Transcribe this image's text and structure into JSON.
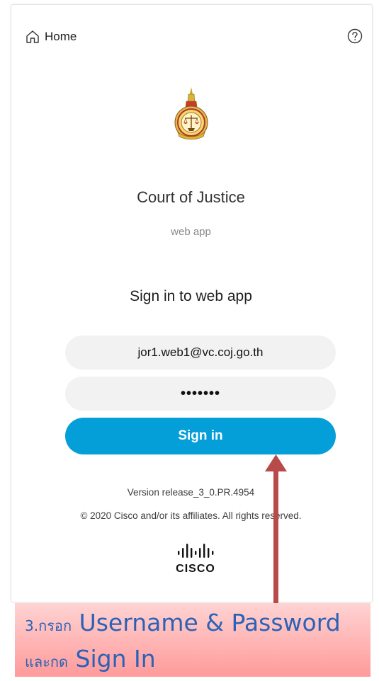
{
  "header": {
    "home_label": "Home",
    "home_icon": "home-icon",
    "help_icon": "help-icon"
  },
  "branding": {
    "logo_icon": "court-of-justice-emblem",
    "org_name": "Court of Justice",
    "app_subtitle": "web app"
  },
  "signin": {
    "title": "Sign in to web app",
    "email_value": "jor1.web1@vc.coj.go.th",
    "password_value": "•••••••",
    "button_label": "Sign in",
    "button_color": "#049fd9"
  },
  "footer": {
    "version": "Version release_3_0.PR.4954",
    "copyright": "© 2020 Cisco and/or its affiliates. All rights reserved.",
    "vendor_logo": "cisco-logo",
    "vendor_name": "CISCO"
  },
  "annotation": {
    "line1_prefix": "3.กรอก",
    "line1_main": "Username & Password",
    "line2_prefix": "และกด",
    "line2_main": "Sign In",
    "text_color": "#2a62b8",
    "arrow_color": "#b84a4a"
  }
}
